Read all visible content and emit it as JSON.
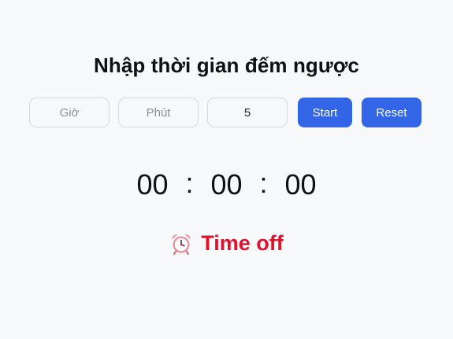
{
  "header": {
    "title": "Nhập thời gian đếm ngược"
  },
  "inputs": {
    "hours": {
      "placeholder": "Giờ",
      "value": ""
    },
    "minutes": {
      "placeholder": "Phút",
      "value": ""
    },
    "seconds": {
      "placeholder": "",
      "value": "5"
    }
  },
  "buttons": {
    "start_label": "Start",
    "reset_label": "Reset"
  },
  "timer": {
    "hours": "00",
    "minutes": "00",
    "seconds": "00",
    "separator": ":"
  },
  "status": {
    "text": "Time off",
    "icon": "alarm-clock-icon"
  },
  "colors": {
    "accent": "#3366e6",
    "alert": "#e0112b",
    "background": "#f7f8fa"
  }
}
